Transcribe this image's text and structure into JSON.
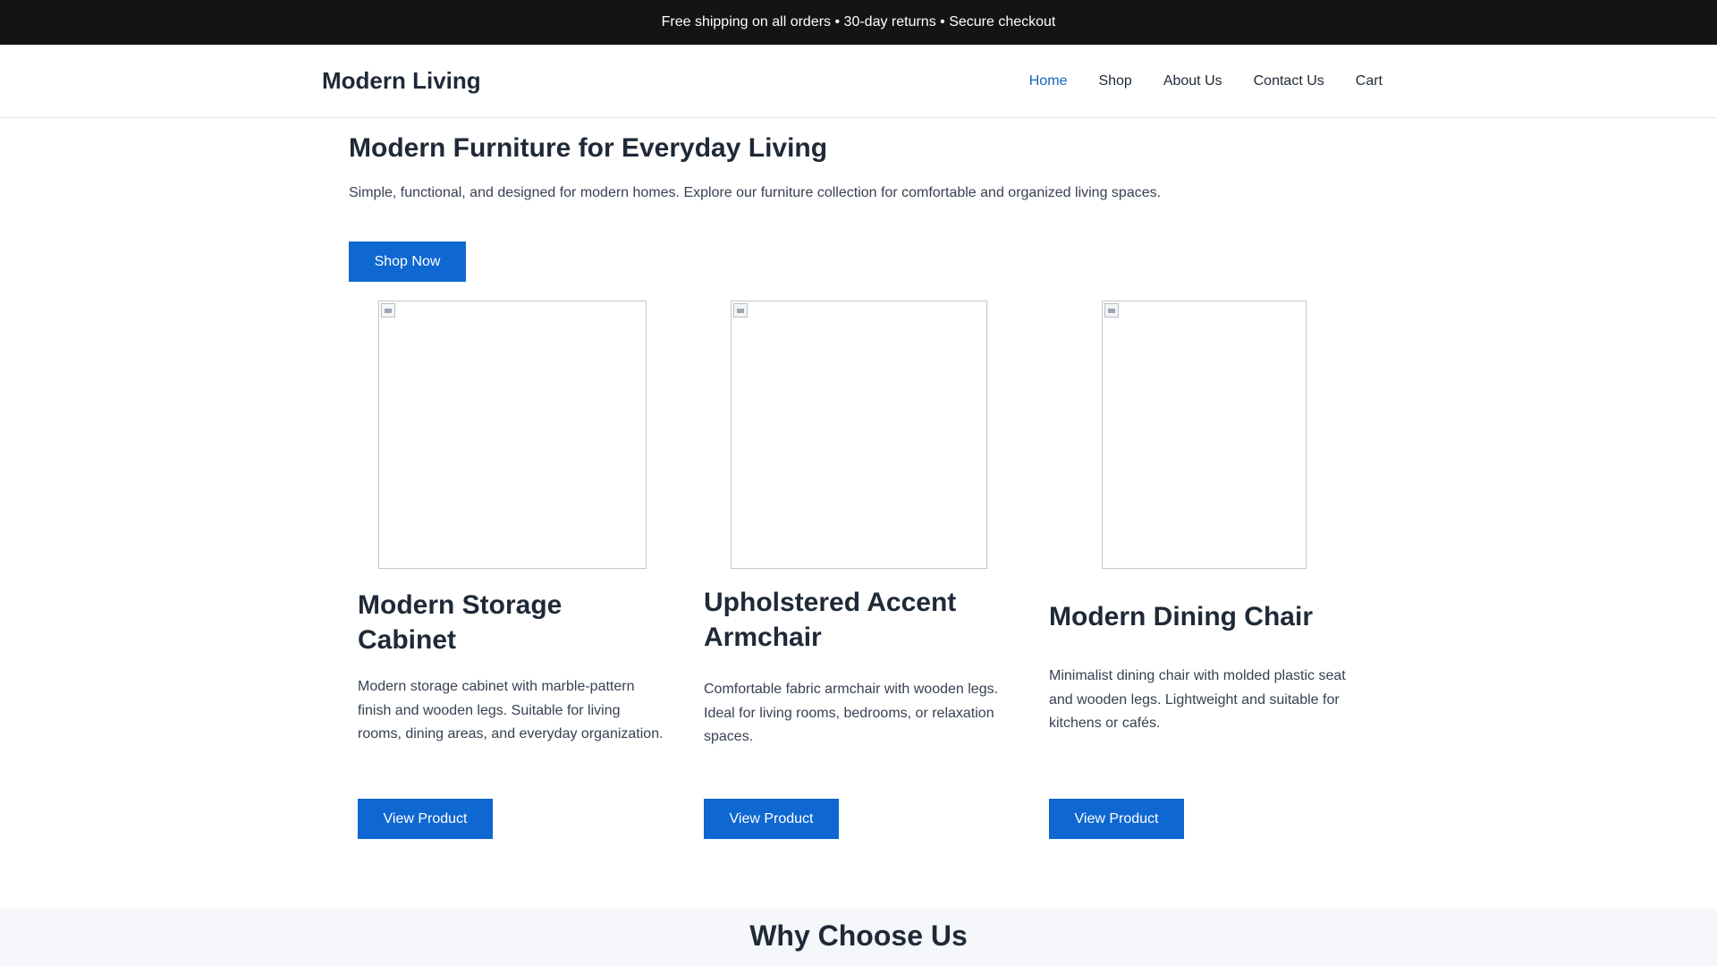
{
  "announcement": "Free shipping on all orders • 30-day returns • Secure checkout",
  "brand": "Modern Living",
  "nav": {
    "home": "Home",
    "shop": "Shop",
    "about": "About Us",
    "contact": "Contact Us",
    "cart": "Cart"
  },
  "hero": {
    "title": "Modern Furniture for Everyday Living",
    "subtitle": "Simple, functional, and designed for modern homes. Explore our furniture collection for comfortable and organized living spaces.",
    "cta": "Shop Now"
  },
  "products": [
    {
      "title_line1": "Modern Storage",
      "title_line2": "Cabinet",
      "desc_line1": "Modern storage cabinet with marble-pattern",
      "desc_line2": "finish and wooden legs. Suitable for living",
      "desc_line3": "rooms, dining areas, and everyday organization.",
      "button": "View Product"
    },
    {
      "title_line1": "Upholstered Accent",
      "title_line2": "Armchair",
      "desc_line1": "Comfortable fabric armchair with wooden legs.",
      "desc_line2": "Ideal for living rooms, bedrooms, or relaxation",
      "desc_line3": "spaces.",
      "button": "View Product"
    },
    {
      "title_line1": "Modern Dining Chair",
      "title_line2": "",
      "desc_line1": "Minimalist dining chair with molded plastic seat",
      "desc_line2": "and wooden legs. Lightweight and suitable for",
      "desc_line3": "kitchens or cafés.",
      "button": "View Product"
    }
  ],
  "why": {
    "title": "Why Choose Us"
  },
  "colors": {
    "accent": "#0f67d1",
    "nav_active": "#1565c0",
    "topbar": "#141414",
    "section_bg": "#f5f7fa"
  }
}
